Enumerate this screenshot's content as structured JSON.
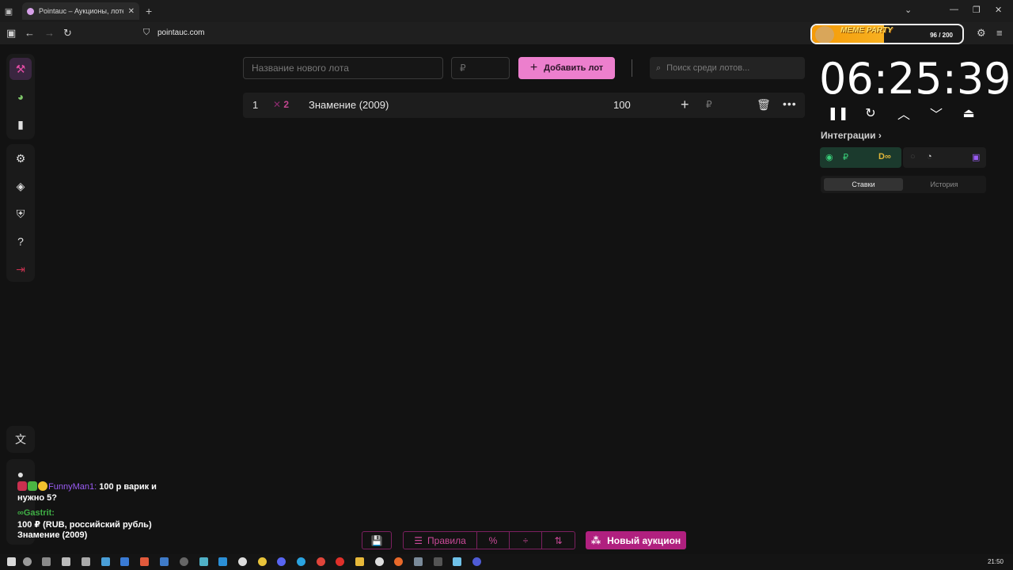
{
  "browser": {
    "tab_title": "Pointauc – Аукционы, лотерея",
    "url": "pointauc.com"
  },
  "widget": {
    "name": "MEME PARTY",
    "count": "96 / 200",
    "progress": 0.48
  },
  "toolbar": {
    "lot_name_placeholder": "Название нового лота",
    "price_placeholder": "₽",
    "add_lot_label": "Добавить лот",
    "search_placeholder": "Поиск среди лотов..."
  },
  "lots": [
    {
      "index": "1",
      "badge": "2",
      "title": "Знамение (2009)",
      "amount": "100",
      "currency": "₽"
    }
  ],
  "timer": {
    "value": "06:25:39"
  },
  "integrations": {
    "title": "Интеграции",
    "tabs": [
      "Ставки",
      "История"
    ]
  },
  "chat": [
    {
      "user": "FunnyMan1:",
      "text_a": "100 р варик и",
      "text_b": "нужно 5?"
    },
    {
      "user": "Gastrit:",
      "text_a": "100 ₽ (RUB, российский рубль)",
      "text_b": "Знамение (2009)"
    }
  ],
  "bottom_bar": {
    "rules_label": "Правила",
    "new_auction_label": "Новый аукцион"
  },
  "taskbar": {
    "clock": "21:50"
  }
}
